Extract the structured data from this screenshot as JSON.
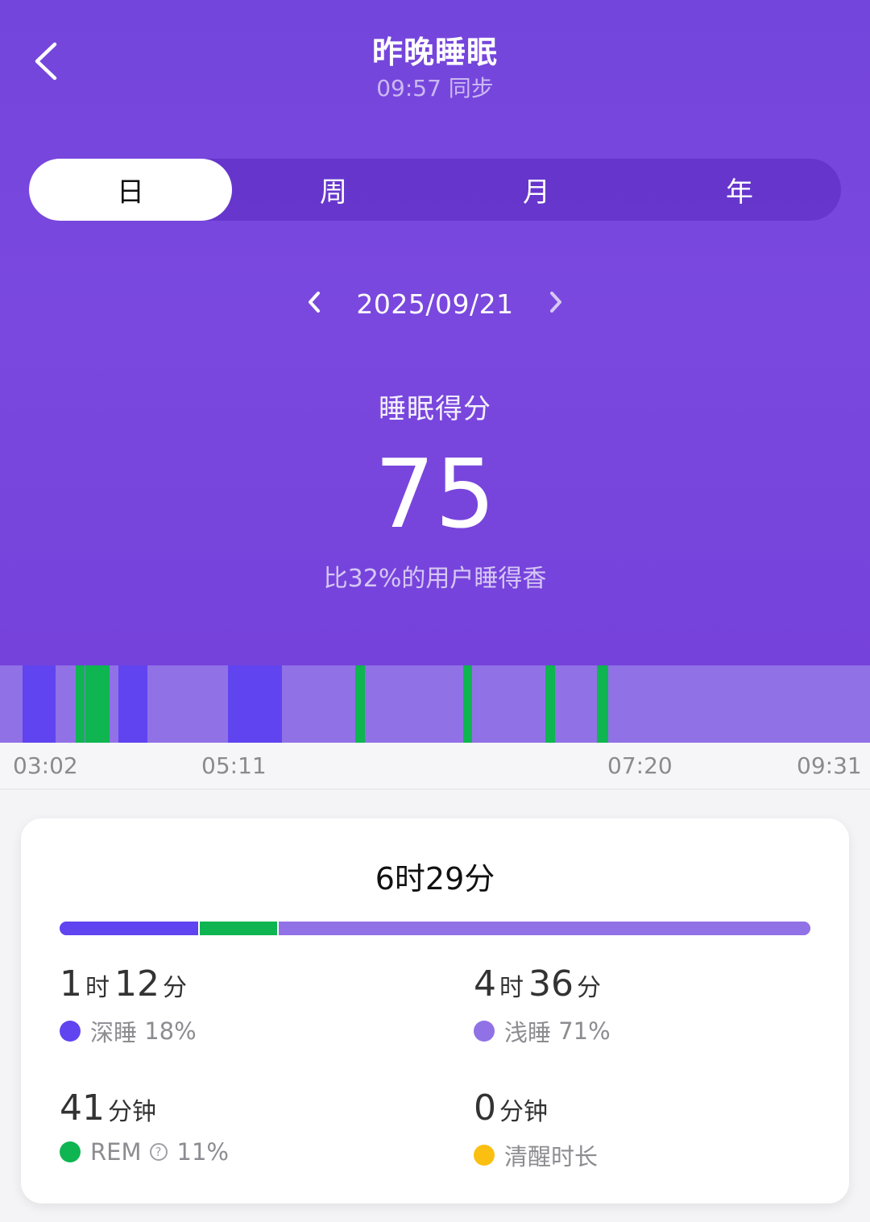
{
  "header": {
    "title": "昨晚睡眠",
    "sync_time": "09:57 同步",
    "back_icon": "chevron-left-icon"
  },
  "tabs": [
    {
      "label": "日",
      "active": true
    },
    {
      "label": "周",
      "active": false
    },
    {
      "label": "月",
      "active": false
    },
    {
      "label": "年",
      "active": false
    }
  ],
  "date_nav": {
    "date": "2025/09/21",
    "prev_icon": "chevron-left-icon",
    "next_icon": "chevron-right-icon"
  },
  "score": {
    "label": "睡眠得分",
    "value": "75",
    "compare": "比32%的用户睡得香"
  },
  "timeline": {
    "start": "03:02",
    "end": "09:31",
    "ticks": [
      "03:02",
      "05:11",
      "07:20",
      "09:31"
    ],
    "stages": [
      {
        "stage": "light",
        "start": "03:02",
        "end": "03:12"
      },
      {
        "stage": "deep",
        "start": "03:12",
        "end": "03:27"
      },
      {
        "stage": "light",
        "start": "03:27",
        "end": "03:36"
      },
      {
        "stage": "rem",
        "start": "03:36",
        "end": "03:40"
      },
      {
        "stage": "light",
        "start": "03:40",
        "end": "03:40"
      },
      {
        "stage": "rem",
        "start": "03:40",
        "end": "03:51"
      },
      {
        "stage": "light",
        "start": "03:51",
        "end": "03:55"
      },
      {
        "stage": "deep",
        "start": "03:55",
        "end": "04:08"
      },
      {
        "stage": "light",
        "start": "04:08",
        "end": "04:44"
      },
      {
        "stage": "deep",
        "start": "04:44",
        "end": "05:08"
      },
      {
        "stage": "light",
        "start": "05:08",
        "end": "05:41"
      },
      {
        "stage": "rem",
        "start": "05:41",
        "end": "05:45"
      },
      {
        "stage": "light",
        "start": "05:45",
        "end": "06:29"
      },
      {
        "stage": "rem",
        "start": "06:29",
        "end": "06:33"
      },
      {
        "stage": "light",
        "start": "06:33",
        "end": "07:06"
      },
      {
        "stage": "rem",
        "start": "07:06",
        "end": "07:10"
      },
      {
        "stage": "light",
        "start": "07:10",
        "end": "07:29"
      },
      {
        "stage": "rem",
        "start": "07:29",
        "end": "07:34"
      },
      {
        "stage": "light",
        "start": "07:34",
        "end": "07:38"
      }
    ]
  },
  "summary": {
    "total": "6时29分",
    "deep": {
      "num1": "1",
      "unit1": "时",
      "num2": "12",
      "unit2": "分",
      "label": "深睡",
      "percent": "18%"
    },
    "light": {
      "num1": "4",
      "unit1": "时",
      "num2": "36",
      "unit2": "分",
      "label": "浅睡",
      "percent": "71%"
    },
    "rem": {
      "num1": "41",
      "unit1": "分钟",
      "label": "REM",
      "percent": "11%"
    },
    "awake": {
      "num1": "0",
      "unit1": "分钟",
      "label": "清醒时长"
    },
    "bar_fractions": {
      "deep": 0.185,
      "rem": 0.105,
      "light": 0.71
    }
  },
  "colors": {
    "hero": "#7445dc",
    "deep": "#6044f0",
    "light": "#9171e6",
    "rem": "#0eb550",
    "awake": "#fbbf12"
  }
}
